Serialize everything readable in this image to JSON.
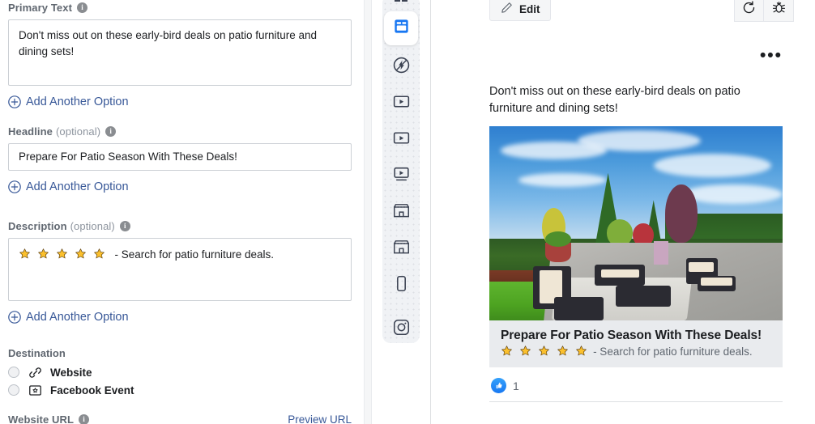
{
  "form": {
    "primary_text": {
      "label": "Primary Text",
      "info_icon": "info-icon",
      "value": "Don't miss out on these early-bird deals on patio furniture and dining sets!",
      "add_option_label": "Add Another Option"
    },
    "headline": {
      "label": "Headline",
      "optional": "(optional)",
      "info_icon": "info-icon",
      "value": "Prepare For Patio Season With These Deals!",
      "add_option_label": "Add Another Option"
    },
    "description": {
      "label": "Description",
      "optional": "(optional)",
      "info_icon": "info-icon",
      "stars": "★★★★★",
      "star_count": 5,
      "value": "- Search for patio furniture deals.",
      "add_option_label": "Add Another Option"
    },
    "destination": {
      "label": "Destination",
      "options": [
        {
          "label": "Website",
          "icon": "link-icon",
          "selected": false
        },
        {
          "label": "Facebook Event",
          "icon": "event-ticket-icon",
          "selected": false
        }
      ]
    },
    "website_url": {
      "label": "Website URL",
      "info_icon": "info-icon",
      "preview_link": "Preview URL"
    }
  },
  "placement_rail": {
    "items": [
      {
        "name": "facebook-feed-icon",
        "active": false,
        "cut_off": true
      },
      {
        "name": "feed-placement-icon",
        "active": true,
        "cut_off": false
      },
      {
        "name": "instant-experience-icon",
        "active": false,
        "cut_off": false
      },
      {
        "name": "in-stream-video-icon",
        "active": false,
        "cut_off": false
      },
      {
        "name": "video-feeds-icon",
        "active": false,
        "cut_off": false
      },
      {
        "name": "video-article-icon",
        "active": false,
        "cut_off": false
      },
      {
        "name": "marketplace-icon",
        "active": false,
        "cut_off": false
      },
      {
        "name": "shops-icon",
        "active": false,
        "cut_off": false
      },
      {
        "name": "mobile-story-icon",
        "active": false,
        "cut_off": false
      },
      {
        "name": "instagram-icon",
        "active": false,
        "cut_off": false,
        "outside": true
      }
    ]
  },
  "preview": {
    "edit_button": {
      "label": "Edit",
      "icon": "pencil-icon"
    },
    "tools": [
      {
        "name": "refresh-icon",
        "label": ""
      },
      {
        "name": "bug-icon",
        "label": ""
      }
    ],
    "more_menu": "•••",
    "ad": {
      "primary_text": "Don't miss out on these early-bird deals on patio furniture and dining sets!",
      "image_alt": "patio furniture set on a stone patio with landscaped backyard",
      "headline": "Prepare For Patio Season With These Deals!",
      "stars": "★★★★★",
      "description": "- Search for patio furniture deals.",
      "like_count": "1",
      "like_icon": "thumbs-up-icon"
    }
  },
  "colors": {
    "link_blue": "#385898",
    "facebook_blue": "#1877f2",
    "star_gold": "#f5b612",
    "label_gray": "#606770",
    "border_gray": "#ccd0d5",
    "footer_gray": "#e9ebee"
  }
}
